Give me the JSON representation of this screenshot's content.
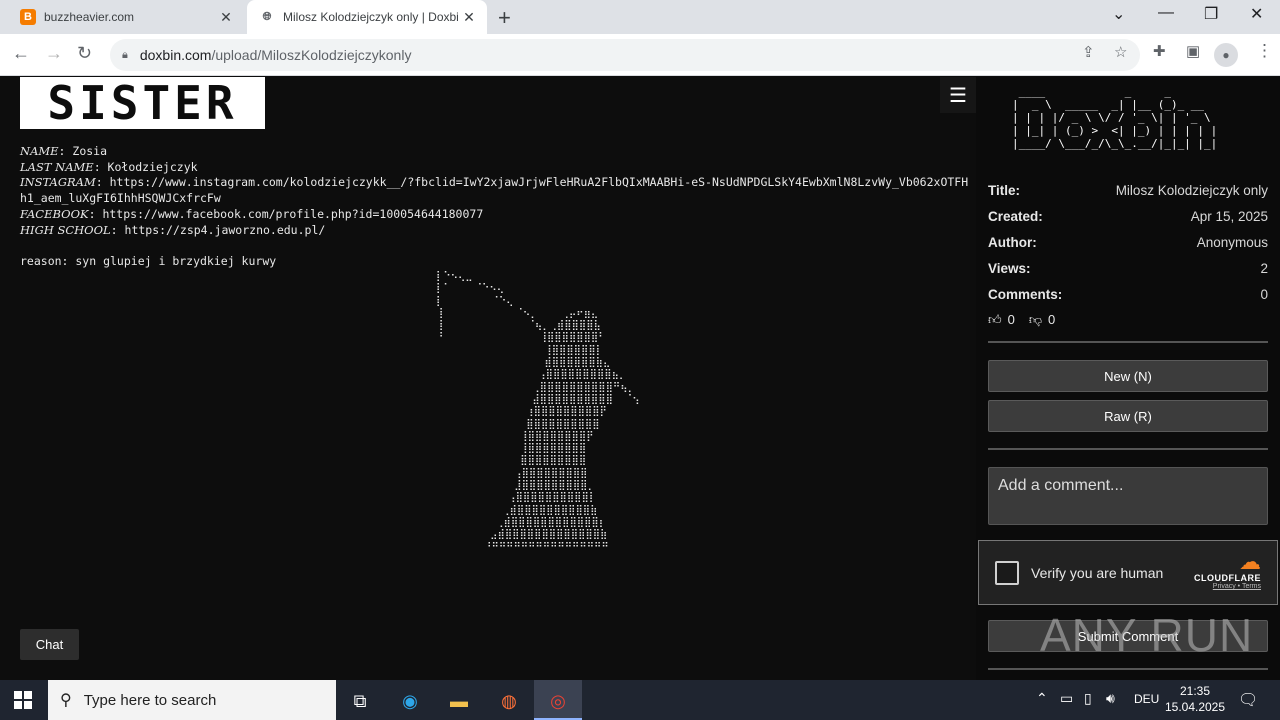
{
  "browser": {
    "tabs": [
      {
        "title": "buzzheavier.com",
        "favicon": "B"
      },
      {
        "title": "Milosz Kolodziejczyk only | Doxbin"
      }
    ],
    "url_host": "doxbin.com",
    "url_path": "/upload/MiloszKolodziejczykonly"
  },
  "paste": {
    "banner": "SISTER",
    "fields": [
      {
        "key": "NAME",
        "value": "Zosia"
      },
      {
        "key": "LAST NAME",
        "value": "Kołodziejczyk"
      },
      {
        "key": "INSTAGRAM",
        "value": "https://www.instagram.com/kolodziejczykk__/?fbclid=IwY2xjawJrjwFleHRuA2FlbQIxMAABHi-eS-NsUdNPDGLSkY4EwbXmlN8LzvWy_Vb062xOTFH"
      },
      {
        "key": "",
        "value": "h1_aem_luXgFI6IhhHSQWJCxfrcFw"
      },
      {
        "key": "FACEBOOK",
        "value": "https://www.facebook.com/profile.php?id=100054644180077"
      },
      {
        "key": "HIGH SCHOOL",
        "value": "https://zsp4.jaworzno.edu.pl/"
      }
    ],
    "reason": "reason: syn glupiej i brzydkiej kurwy",
    "chat_label": "Chat"
  },
  "sidebar": {
    "meta": [
      {
        "key": "Title:",
        "value": "Milosz Kolodziejczyk only"
      },
      {
        "key": "Created:",
        "value": "Apr 15, 2025"
      },
      {
        "key": "Author:",
        "value": "Anonymous"
      },
      {
        "key": "Views:",
        "value": "2"
      },
      {
        "key": "Comments:",
        "value": "0"
      }
    ],
    "likes": "0",
    "dislikes": "0",
    "new_label": "New (N)",
    "raw_label": "Raw (R)",
    "comment_placeholder": "Add a comment...",
    "captcha_label": "Verify you are human",
    "captcha_brand": "CLOUDFLARE",
    "captcha_links": "Privacy • Terms",
    "submit_label": "Submit Comment"
  },
  "watermark": "ANY RUN",
  "taskbar": {
    "search_placeholder": "Type here to search",
    "lang": "DEU",
    "time": "21:35",
    "date": "15.04.2025"
  },
  "colors": {
    "accent_cloudflare": "#f38020",
    "page_bg": "#0d0d0d",
    "taskbar_bg": "#1f2530"
  }
}
